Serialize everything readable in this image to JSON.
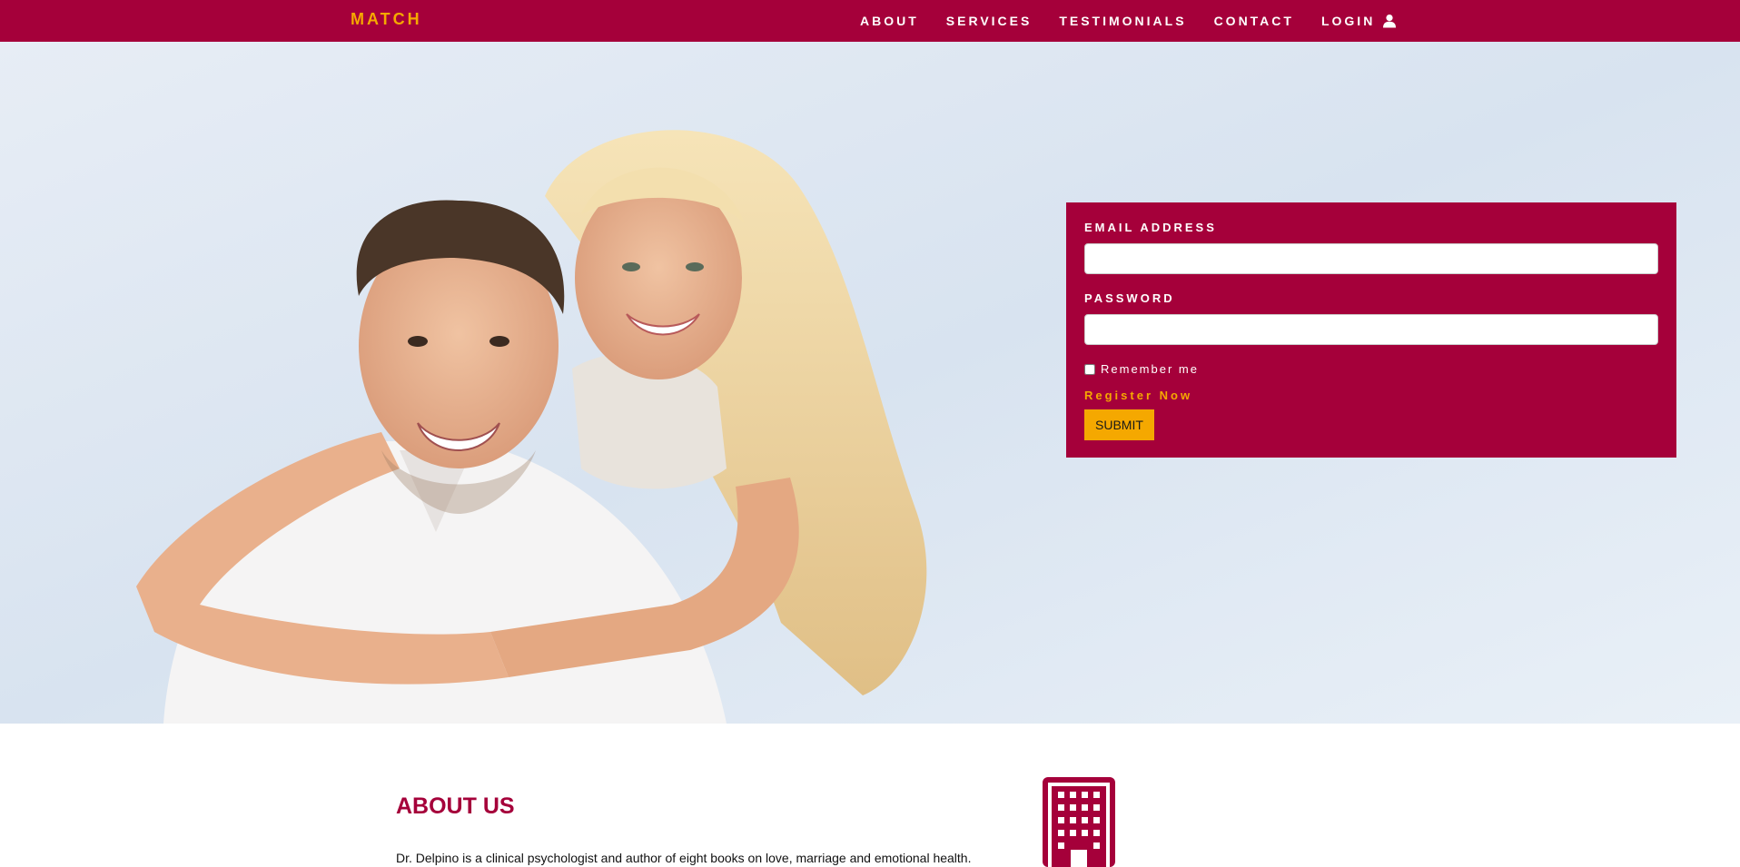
{
  "navbar": {
    "brand": "MATCH",
    "links": [
      {
        "label": "ABOUT"
      },
      {
        "label": "SERVICES"
      },
      {
        "label": "TESTIMONIALS"
      },
      {
        "label": "CONTACT"
      },
      {
        "label": "LOGIN",
        "icon": "user-icon"
      }
    ]
  },
  "login_form": {
    "email_label": "EMAIL ADDRESS",
    "email_value": "",
    "password_label": "PASSWORD",
    "password_value": "",
    "remember_label": "Remember me",
    "remember_checked": false,
    "register_link": "Register Now",
    "submit_label": "SUBMIT"
  },
  "about": {
    "title": "ABOUT US",
    "text": "Dr. Delpino is a clinical psychologist and author of eight books on love, marriage and emotional health.",
    "icon": "building-icon"
  },
  "colors": {
    "brand": "#a5003a",
    "accent": "#f5a800",
    "text": "#111111"
  }
}
